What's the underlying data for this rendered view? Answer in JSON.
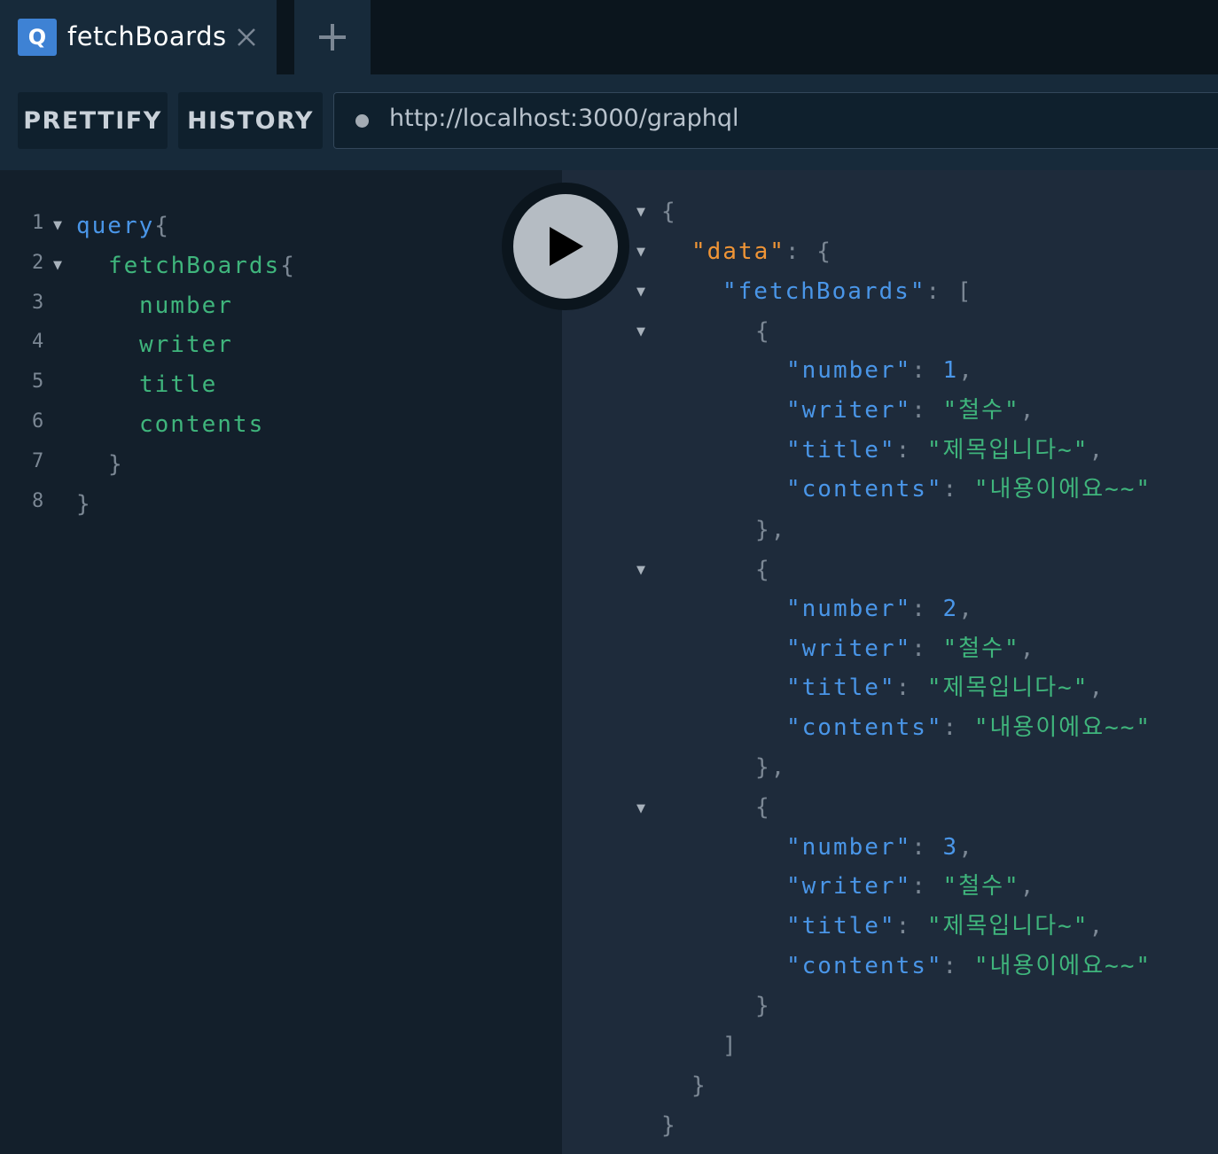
{
  "tabs": [
    {
      "icon_letter": "Q",
      "title": "fetchBoards"
    }
  ],
  "toolbar": {
    "prettify_label": "PRETTIFY",
    "history_label": "HISTORY",
    "url": "http://localhost:3000/graphql"
  },
  "query_editor": {
    "line_numbers": [
      "1",
      "2",
      "3",
      "4",
      "5",
      "6",
      "7",
      "8"
    ],
    "keyword": "query",
    "open_brace": "{",
    "close_brace": "}",
    "operation": "fetchBoards",
    "fields": [
      "number",
      "writer",
      "title",
      "contents"
    ]
  },
  "result": {
    "root_key": "\"data\"",
    "list_key": "\"fetchBoards\"",
    "field_keys": {
      "number": "\"number\"",
      "writer": "\"writer\"",
      "title": "\"title\"",
      "contents": "\"contents\""
    },
    "boards": [
      {
        "number": "1",
        "writer": "\"철수\"",
        "title": "\"제목입니다~\"",
        "contents": "\"내용이에요~~\""
      },
      {
        "number": "2",
        "writer": "\"철수\"",
        "title": "\"제목입니다~\"",
        "contents": "\"내용이에요~~\""
      },
      {
        "number": "3",
        "writer": "\"철수\"",
        "title": "\"제목입니다~\"",
        "contents": "\"내용이에요~~\""
      }
    ]
  },
  "icons": {
    "tab_close": "close-icon",
    "tab_add": "plus-icon",
    "run": "play-icon",
    "fold": "caret-down-icon",
    "url_status": "dot-icon"
  }
}
